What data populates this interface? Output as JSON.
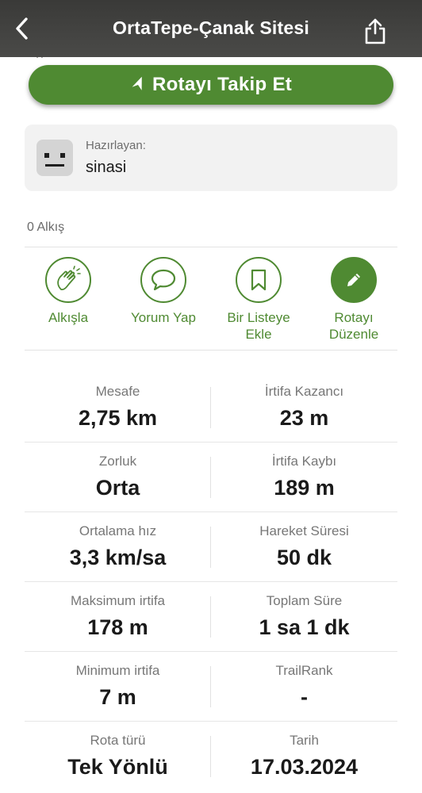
{
  "header": {
    "title": "OrtaTepe-Çanak Sitesi",
    "back_icon": "chevron-left-icon",
    "share_icon": "share-icon"
  },
  "follow_button": {
    "label": "Rotayı Takip Et",
    "icon": "navigation-arrow-icon"
  },
  "author": {
    "prepared_by_label": "Hazırlayan:",
    "name": "sinasi",
    "avatar_icon": "robot-face-icon"
  },
  "claps_text": "0 Alkış",
  "actions": [
    {
      "label": "Alkışla",
      "icon": "clap-hands-icon"
    },
    {
      "label": "Yorum Yap",
      "icon": "speech-bubble-icon"
    },
    {
      "label": "Bir Listeye Ekle",
      "icon": "bookmark-icon"
    },
    {
      "label": "Rotayı Düzenle",
      "icon": "pencil-icon"
    }
  ],
  "stats": [
    [
      {
        "label": "Mesafe",
        "value": "2,75 km"
      },
      {
        "label": "İrtifa Kazancı",
        "value": "23 m"
      }
    ],
    [
      {
        "label": "Zorluk",
        "value": "Orta"
      },
      {
        "label": "İrtifa Kaybı",
        "value": "189 m"
      }
    ],
    [
      {
        "label": "Ortalama hız",
        "value": "3,3 km/sa"
      },
      {
        "label": "Hareket Süresi",
        "value": "50 dk"
      }
    ],
    [
      {
        "label": "Maksimum irtifa",
        "value": "178 m"
      },
      {
        "label": "Toplam Süre",
        "value": "1 sa 1 dk"
      }
    ],
    [
      {
        "label": "Minimum irtifa",
        "value": "7 m"
      },
      {
        "label": "TrailRank",
        "value": "-"
      }
    ],
    [
      {
        "label": "Rota türü",
        "value": "Tek Yönlü"
      },
      {
        "label": "Tarih",
        "value": "17.03.2024"
      }
    ]
  ],
  "colors": {
    "accent": "#4f8a32",
    "header_bg": "#3f3f3d"
  }
}
